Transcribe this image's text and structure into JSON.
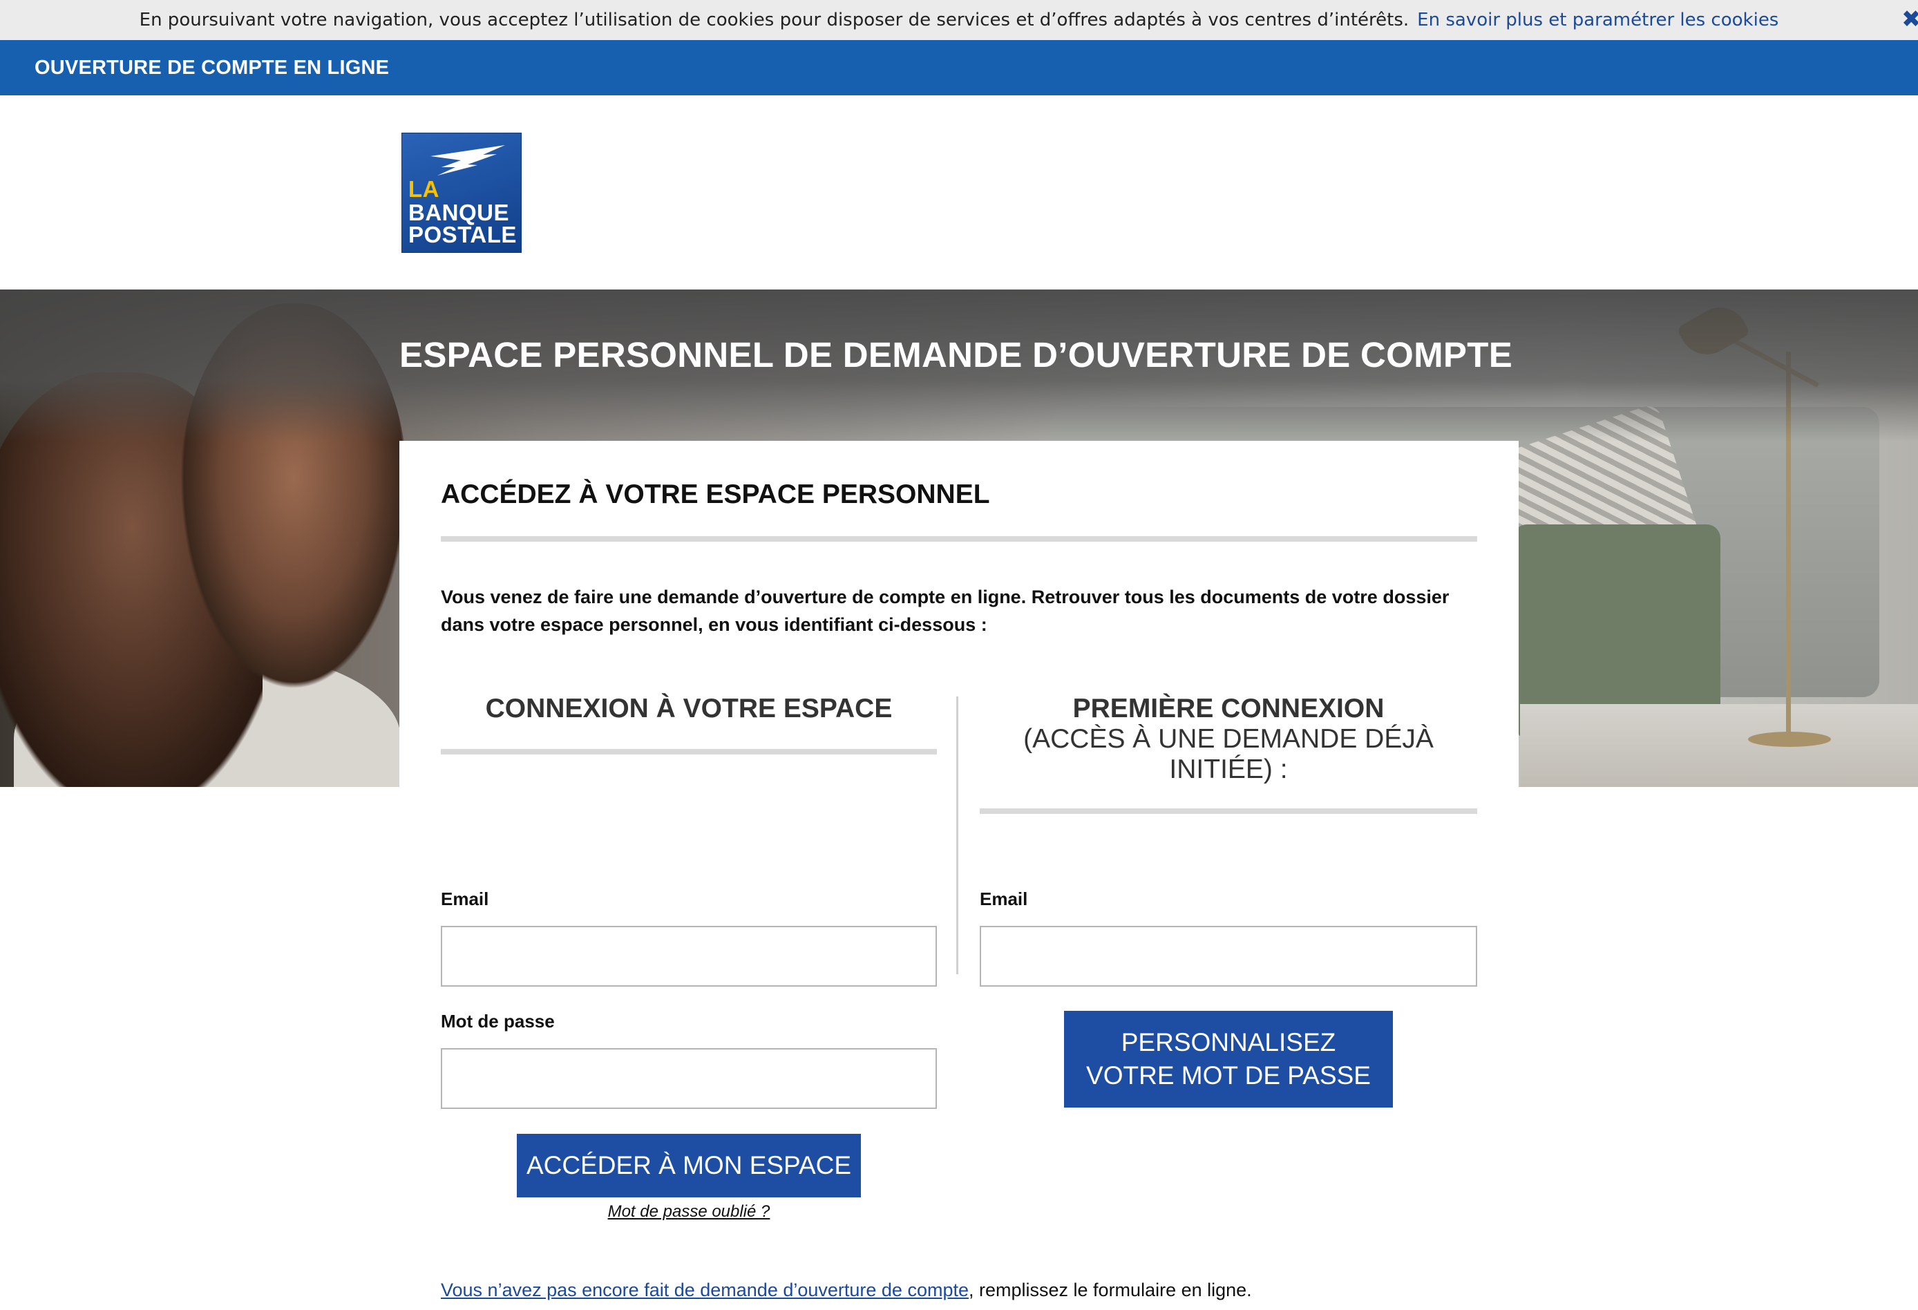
{
  "cookie_bar": {
    "text": "En poursuivant votre navigation, vous acceptez l’utilisation de cookies pour disposer de services et d’offres adaptés à vos centres d’intérêts.",
    "link": "En savoir plus et paramétrer les cookies",
    "close_icon": "close-icon"
  },
  "topbar": {
    "title": "OUVERTURE DE COMPTE EN LIGNE"
  },
  "logo": {
    "line1": "LA",
    "line2": "BANQUE",
    "line3": "POSTALE"
  },
  "hero": {
    "title": "ESPACE PERSONNEL DE DEMANDE D’OUVERTURE DE COMPTE"
  },
  "card": {
    "title": "ACCÉDEZ À VOTRE ESPACE PERSONNEL",
    "intro": "Vous venez de faire une demande d’ouverture de compte en ligne. Retrouver tous les documents de votre dossier dans votre espace personnel, en vous identifiant ci-dessous :",
    "login": {
      "title": "CONNEXION À VOTRE ESPACE",
      "email_label": "Email",
      "email_value": "",
      "password_label": "Mot de passe",
      "password_value": "",
      "submit_label": "ACCÉDER À MON ESPACE",
      "forgot_label": "Mot de passe oublié ?"
    },
    "first": {
      "title_line1": "PREMIÈRE CONNEXION",
      "title_line2": "(ACCÈS À UNE DEMANDE DÉJÀ INITIÉE) :",
      "email_label": "Email",
      "email_value": "",
      "submit_label": "PERSONNALISEZ VOTRE MOT DE PASSE"
    }
  },
  "footer_line": {
    "link": "Vous n’avez pas encore fait de demande d’ouverture de compte",
    "rest": ", remplissez le formulaire en ligne."
  },
  "colors": {
    "brand_blue": "#1760b0",
    "button_blue": "#1d4ea3",
    "logo_yellow": "#f6c200"
  }
}
